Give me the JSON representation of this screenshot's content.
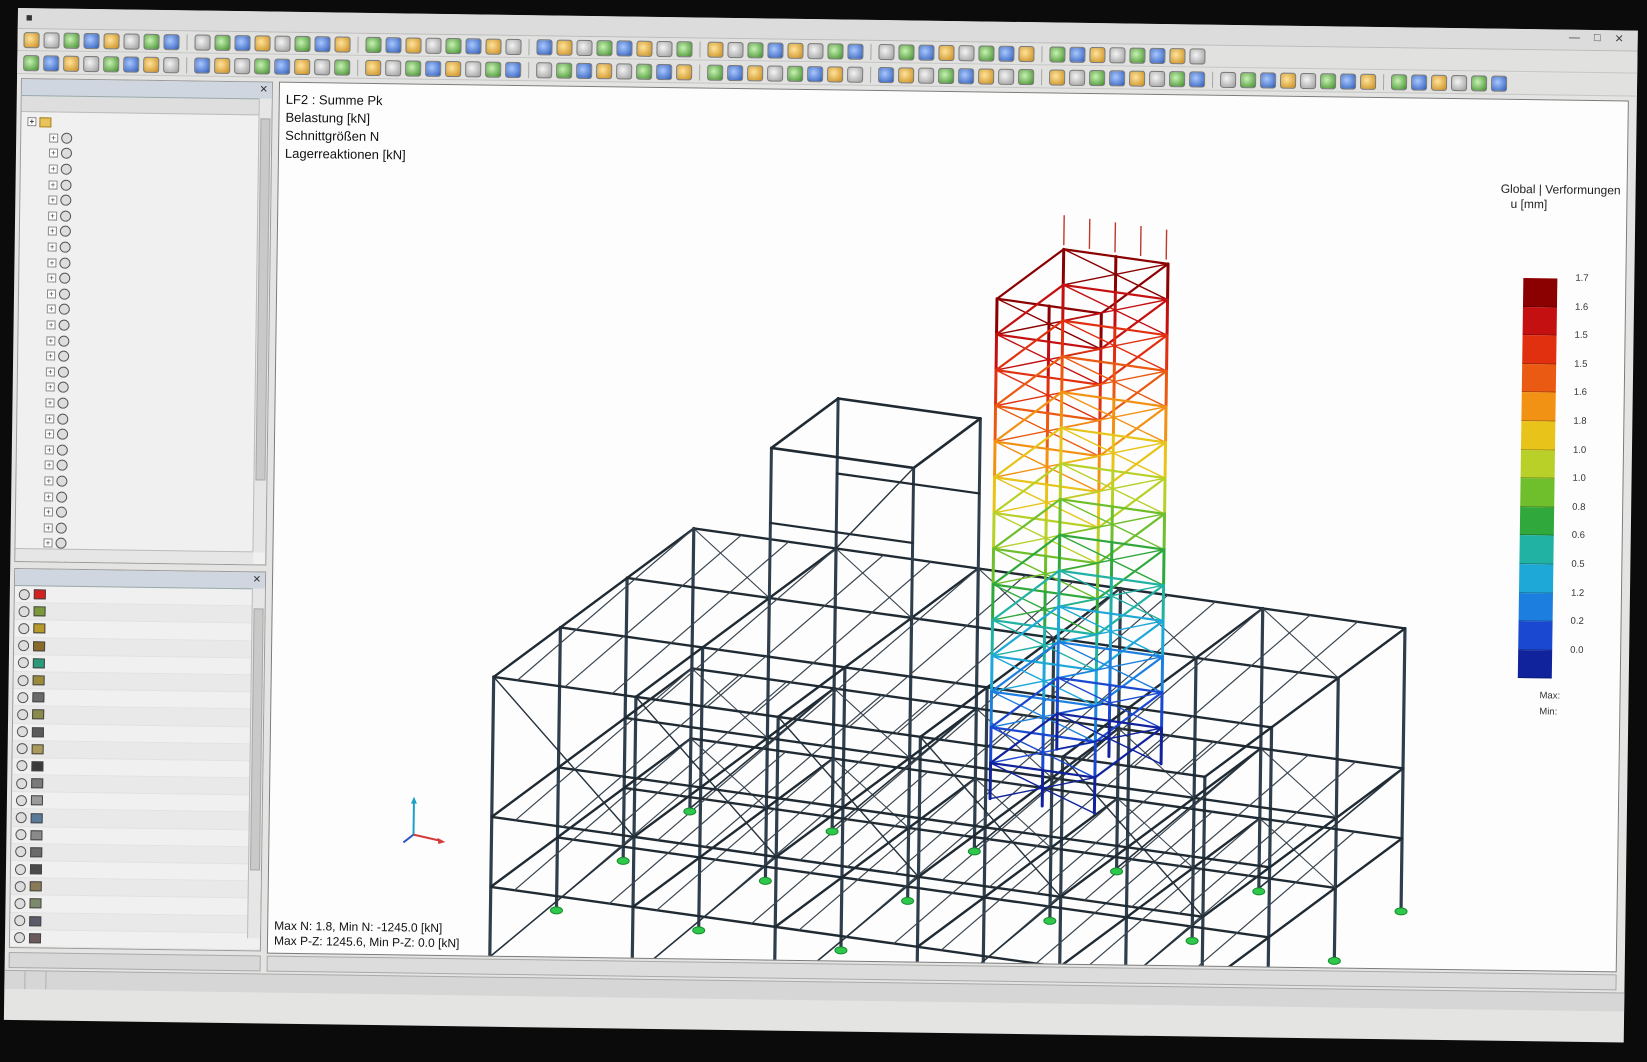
{
  "viewport": {
    "title_lines": [
      "LF2 : Summe Pk",
      "Belastung [kN]",
      "Schnittgrößen N",
      "Lagerreaktionen [kN]"
    ],
    "status_lines": [
      "Max N: 1.8, Min N: -1245.0 [kN]",
      "Max P-Z: 1245.6, Min P-Z: 0.0 [kN]"
    ]
  },
  "legend": {
    "header_lines": [
      "Global | Verformungen",
      "u [mm]"
    ],
    "colors": [
      "#8b0000",
      "#c41010",
      "#e03010",
      "#ea5a12",
      "#f29214",
      "#e8c41a",
      "#b8d028",
      "#6fbf2c",
      "#30a83c",
      "#22b2a4",
      "#1ea8d8",
      "#1c7fe0",
      "#1a48d0",
      "#10239c"
    ],
    "values": [
      "1.7",
      "1.6",
      "1.5",
      "1.5",
      "1.6",
      "1.8",
      "1.0",
      "1.0",
      "0.8",
      "0.6",
      "0.5",
      "1.2",
      "0.2",
      "0.0"
    ],
    "max_label": "Max:",
    "min_label": "Min:"
  },
  "icons": [
    "app-icon",
    "open-icon",
    "save-icon",
    "print-icon",
    "undo-icon",
    "redo-icon",
    "zoom-icon",
    "rotate-icon",
    "view-icon",
    "render-icon"
  ]
}
